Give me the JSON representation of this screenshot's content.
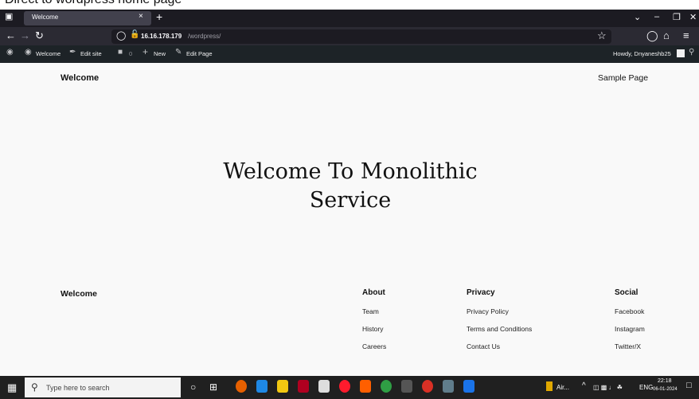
{
  "caption": "Direct to wordpress home page",
  "browser": {
    "tab_title": "Welcome",
    "tab_close": "×",
    "new_tab": "+",
    "url_host": "16.16.178.179",
    "url_path": "/wordpress/"
  },
  "admin_bar": {
    "site_label": "Welcome",
    "edit_site": "Edit site",
    "comments_count": "0",
    "new_label": "New",
    "edit_page": "Edit Page",
    "howdy": "Howdy, Dnyaneshb25"
  },
  "page": {
    "site_title": "Welcome",
    "nav_link": "Sample Page",
    "hero_line1": "Welcome To Monolithic",
    "hero_line2": "Service",
    "footer_title": "Welcome",
    "columns": [
      {
        "heading": "About",
        "links": [
          "Team",
          "History",
          "Careers"
        ]
      },
      {
        "heading": "Privacy",
        "links": [
          "Privacy Policy",
          "Terms and Conditions",
          "Contact Us"
        ]
      },
      {
        "heading": "Social",
        "links": [
          "Facebook",
          "Instagram",
          "Twitter/X"
        ]
      }
    ]
  },
  "taskbar": {
    "search_placeholder": "Type here to search",
    "weather": "Air...",
    "language": "ENG",
    "time": "22:18",
    "date": "06-01-2024"
  },
  "colors": {
    "tab_strip": "#1c1b22",
    "nav_bar": "#2b2a33",
    "admin_bar": "#1d2327",
    "page_bg": "#f9f9f9",
    "taskbar": "#202020"
  }
}
